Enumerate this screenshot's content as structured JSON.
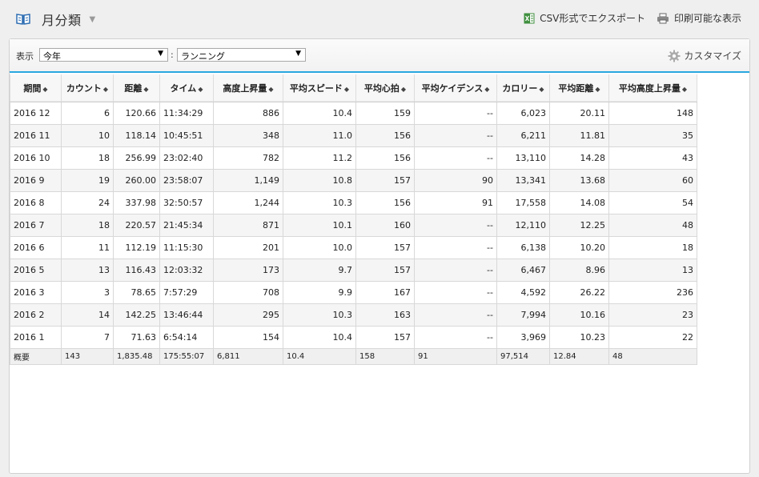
{
  "header": {
    "title": "月分類",
    "csv_export": "CSV形式でエクスポート",
    "print_view": "印刷可能な表示"
  },
  "toolbar": {
    "show_label": "表示",
    "period_value": "今年",
    "separator": ":",
    "activity_value": "ランニング",
    "customize_label": "カスタマイズ"
  },
  "table": {
    "columns": [
      "期間",
      "カウント",
      "距離",
      "タイム",
      "高度上昇量",
      "平均スピード",
      "平均心拍",
      "平均ケイデンス",
      "カロリー",
      "平均距離",
      "平均高度上昇量"
    ],
    "rows": [
      [
        "2016 12",
        "6",
        "120.66",
        "11:34:29",
        "886",
        "10.4",
        "159",
        "--",
        "6,023",
        "20.11",
        "148"
      ],
      [
        "2016 11",
        "10",
        "118.14",
        "10:45:51",
        "348",
        "11.0",
        "156",
        "--",
        "6,211",
        "11.81",
        "35"
      ],
      [
        "2016 10",
        "18",
        "256.99",
        "23:02:40",
        "782",
        "11.2",
        "156",
        "--",
        "13,110",
        "14.28",
        "43"
      ],
      [
        "2016 9",
        "19",
        "260.00",
        "23:58:07",
        "1,149",
        "10.8",
        "157",
        "90",
        "13,341",
        "13.68",
        "60"
      ],
      [
        "2016 8",
        "24",
        "337.98",
        "32:50:57",
        "1,244",
        "10.3",
        "156",
        "91",
        "17,558",
        "14.08",
        "54"
      ],
      [
        "2016 7",
        "18",
        "220.57",
        "21:45:34",
        "871",
        "10.1",
        "160",
        "--",
        "12,110",
        "12.25",
        "48"
      ],
      [
        "2016 6",
        "11",
        "112.19",
        "11:15:30",
        "201",
        "10.0",
        "157",
        "--",
        "6,138",
        "10.20",
        "18"
      ],
      [
        "2016 5",
        "13",
        "116.43",
        "12:03:32",
        "173",
        "9.7",
        "157",
        "--",
        "6,467",
        "8.96",
        "13"
      ],
      [
        "2016 3",
        "3",
        "78.65",
        "7:57:29",
        "708",
        "9.9",
        "167",
        "--",
        "4,592",
        "26.22",
        "236"
      ],
      [
        "2016 2",
        "14",
        "142.25",
        "13:46:44",
        "295",
        "10.3",
        "163",
        "--",
        "7,994",
        "10.16",
        "23"
      ],
      [
        "2016 1",
        "7",
        "71.63",
        "6:54:14",
        "154",
        "10.4",
        "157",
        "--",
        "3,969",
        "10.23",
        "22"
      ]
    ],
    "summary": [
      "概要",
      "143",
      "1,835.48",
      "175:55:07",
      "6,811",
      "10.4",
      "158",
      "91",
      "97,514",
      "12.84",
      "48"
    ]
  },
  "icons": {
    "title_icon": "book-icon",
    "csv_icon": "excel-icon",
    "print_icon": "printer-icon",
    "customize_icon": "gear-icon",
    "sort_icon": "sort-icon"
  },
  "colors": {
    "accent": "#29a8e0",
    "book": "#2f6fb3",
    "excel": "#3f8f3f"
  }
}
